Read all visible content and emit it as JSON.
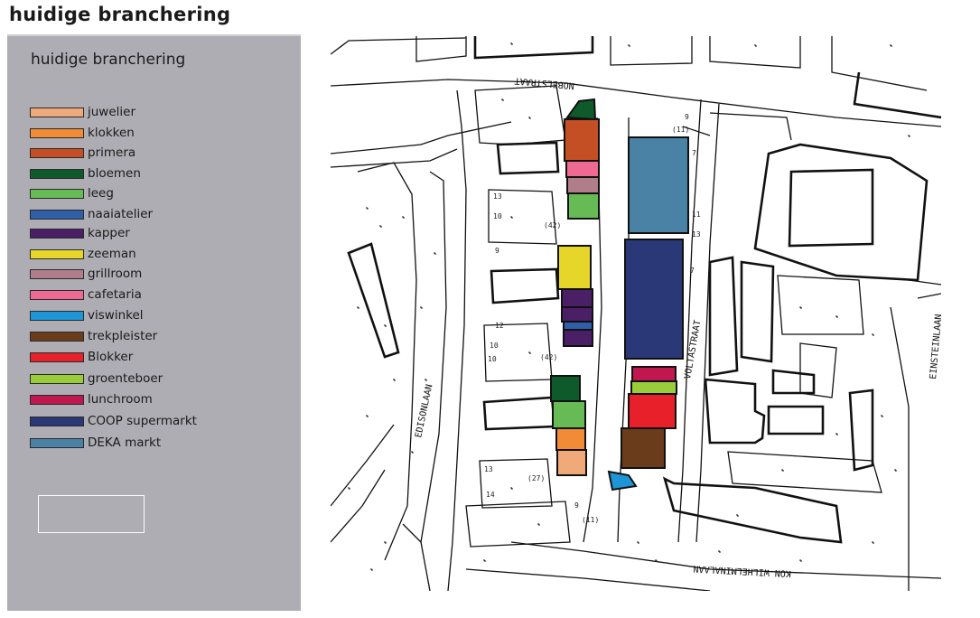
{
  "page_title": "huidige branchering",
  "legend": {
    "title": "huidige branchering",
    "items": [
      {
        "label": "juwelier",
        "color": "#f0a978"
      },
      {
        "label": "klokken",
        "color": "#f28b35"
      },
      {
        "label": "primera",
        "color": "#c54f25"
      },
      {
        "label": "bloemen",
        "color": "#0f5a2b"
      },
      {
        "label": "leeg",
        "color": "#66bb55"
      },
      {
        "label": "naaiatelier",
        "color": "#2f5fa8"
      },
      {
        "label": "kapper",
        "color": "#4a1f66"
      },
      {
        "label": "zeeman",
        "color": "#e6d62a"
      },
      {
        "label": "grillroom",
        "color": "#b07d8a"
      },
      {
        "label": "cafetaria",
        "color": "#ee6a93"
      },
      {
        "label": "viswinkel",
        "color": "#1d95d6"
      },
      {
        "label": "trekpleister",
        "color": "#6a3c1c"
      },
      {
        "label": "Blokker",
        "color": "#e8202a"
      },
      {
        "label": "groenteboer",
        "color": "#9acd3a"
      },
      {
        "label": "lunchroom",
        "color": "#c0174f"
      },
      {
        "label": "COOP supermarkt",
        "color": "#2a3877"
      },
      {
        "label": "DEKA markt",
        "color": "#4a82a6"
      }
    ]
  },
  "map": {
    "streets": {
      "nobelstraat": "NOBELSTRAAT",
      "voltastraat": "VOLTASTRAAT",
      "edisonlaan": "EDISONLAAN",
      "einsteinlaan": "EINSTEINLAAN",
      "kon_wilhelminalaan": "KON WILHELMINALAAN"
    },
    "house_numbers": [
      "9",
      "(11)",
      "13",
      "10",
      "(42)",
      "9",
      "10",
      "(42)",
      "10",
      "12",
      "13",
      "(27)",
      "14",
      "9",
      "(11)",
      "7",
      "11",
      "13",
      "7"
    ]
  }
}
